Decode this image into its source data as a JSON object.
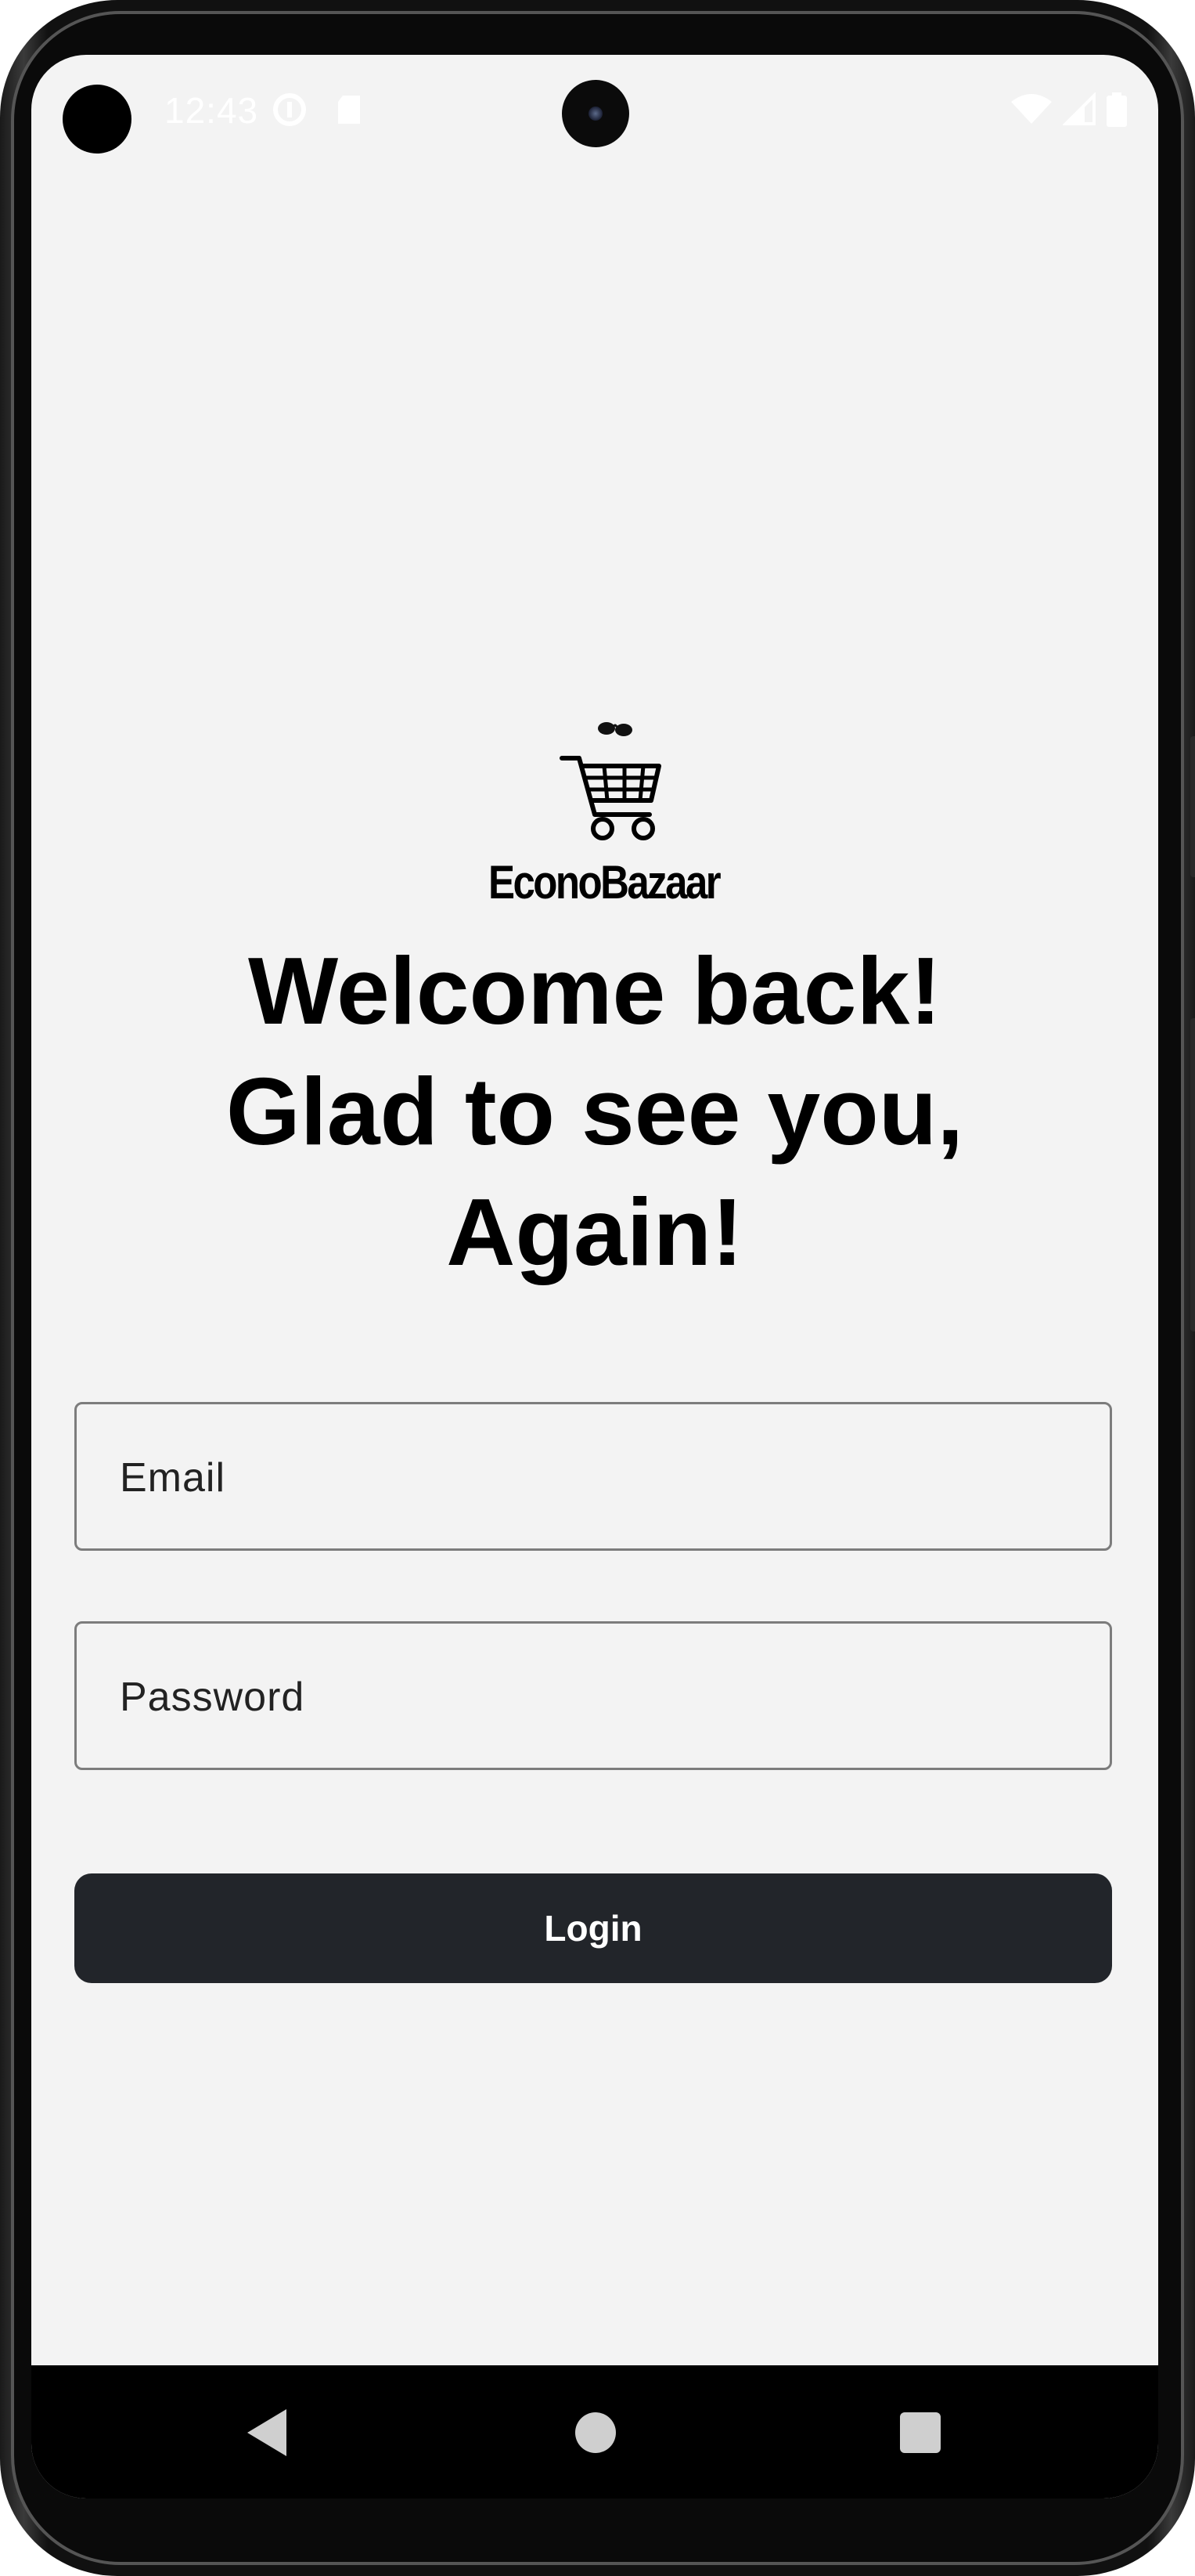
{
  "status_bar": {
    "time": "12:43",
    "icons": [
      "data-saver-icon",
      "sd-card-icon",
      "wifi-icon",
      "signal-icon",
      "battery-icon"
    ]
  },
  "logo": {
    "brand_name": "EconoBazaar",
    "icon": "shopping-cart-icon"
  },
  "heading": {
    "line1": "Welcome back!",
    "line2": "Glad to see you,",
    "line3": "Again!"
  },
  "form": {
    "email_placeholder": "Email",
    "password_placeholder": "Password",
    "login_label": "Login"
  },
  "nav_bar": {
    "icons": [
      "back-icon",
      "home-icon",
      "recents-icon"
    ]
  },
  "colors": {
    "background": "#f3f3f3",
    "button": "#22252a",
    "button_text": "#ffffff",
    "field_border": "#7c7c7c"
  }
}
